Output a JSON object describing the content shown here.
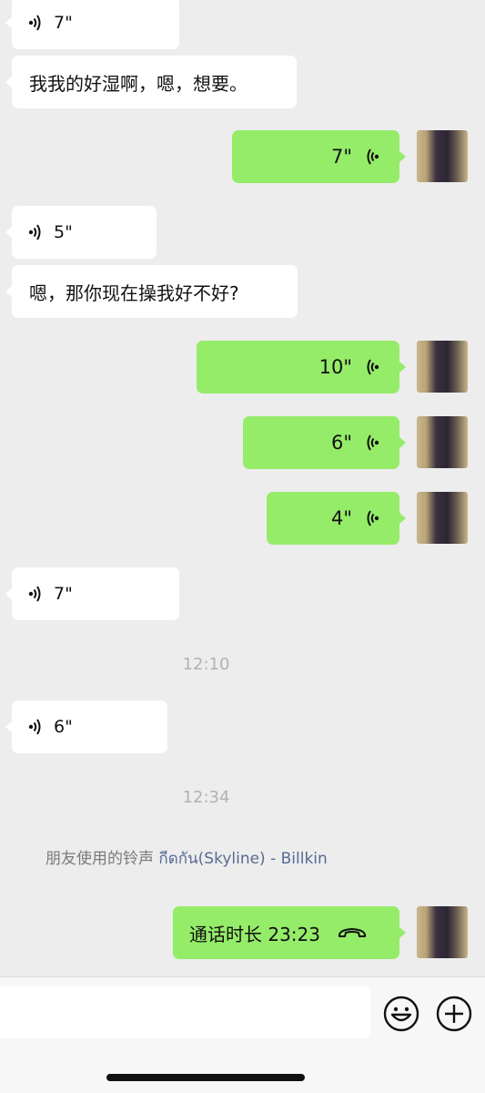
{
  "messages": {
    "m1": {
      "duration": "7\""
    },
    "m2": {
      "text": "我我的好湿啊，嗯，想要。"
    },
    "m3": {
      "duration": "7\""
    },
    "m4": {
      "duration": "5\""
    },
    "m5": {
      "text": "嗯，那你现在操我好不好?"
    },
    "m6": {
      "duration": "10\""
    },
    "m7": {
      "duration": "6\""
    },
    "m8": {
      "duration": "4\""
    },
    "m9": {
      "duration": "7\""
    },
    "m10": {
      "duration": "6\""
    },
    "m11": {
      "text": "通话时长 23:23"
    }
  },
  "timestamps": {
    "t1": "12:10",
    "t2": "12:34"
  },
  "system": {
    "prefix": "朋友使用的铃声 ",
    "song": "กีดกัน(Skyline) - Billkin"
  },
  "icons": {
    "voice_in": "voice-wave-icon",
    "voice_out": "voice-wave-icon",
    "call": "phone-hangup-icon",
    "emoji": "emoji-icon",
    "plus": "plus-icon"
  },
  "colors": {
    "outgoing_bubble": "#95ec69",
    "incoming_bubble": "#ffffff",
    "background": "#ededed",
    "link": "#576b95"
  }
}
